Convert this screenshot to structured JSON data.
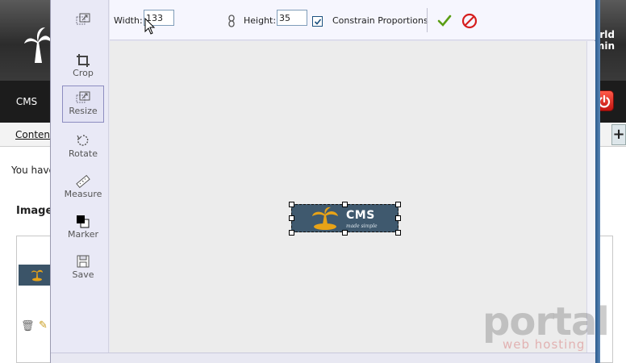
{
  "background_page": {
    "brand_lines": [
      "World",
      "Admin"
    ],
    "nav_cms": "CMS",
    "subnav_content": "Content",
    "plus_label": "+",
    "message_fragment": "You have",
    "heading_fragment": "Image",
    "right_fragment": ")"
  },
  "editor": {
    "tools": [
      {
        "name": "crop",
        "label": "Crop",
        "icon": "crop-icon"
      },
      {
        "name": "resize",
        "label": "Resize",
        "icon": "resize-icon",
        "active": true
      },
      {
        "name": "rotate",
        "label": "Rotate",
        "icon": "rotate-icon"
      },
      {
        "name": "measure",
        "label": "Measure",
        "icon": "ruler-icon"
      },
      {
        "name": "marker",
        "label": "Marker",
        "icon": "marker-icon"
      },
      {
        "name": "save",
        "label": "Save",
        "icon": "floppy-disk-icon"
      }
    ],
    "options": {
      "width_label": "Width:",
      "width_value": "133",
      "height_label": "Height:",
      "height_value": "35",
      "constrain_label": "Constrain Proportions",
      "constrain_checked": true
    },
    "image": {
      "brand_text": "CMS",
      "tagline": "made simple",
      "background_color": "#3f596e",
      "accent_color": "#e8a317"
    }
  },
  "watermark": {
    "main": "portal",
    "sub": "web hosting"
  },
  "colors": {
    "accept_green": "#5a9e14",
    "cancel_red": "#d61e1e",
    "power_red": "#d8281c"
  }
}
